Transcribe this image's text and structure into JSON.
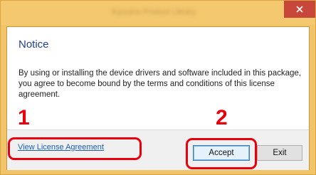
{
  "window": {
    "title": "Kyocera Product Library"
  },
  "notice": {
    "title": "Notice",
    "body": "By using or installing the device drivers and software included in this package, you agree to become bound by the terms and conditions of this license agreement."
  },
  "footer": {
    "link_label": "View License Agreement",
    "accept_label": "Accept",
    "exit_label": "Exit"
  },
  "callouts": {
    "one": "1",
    "two": "2"
  },
  "colors": {
    "titlebar": "#f3c86f",
    "close_button": "#c8463a",
    "heading": "#1f3f8c",
    "link": "#1a5fb4",
    "callout": "#e8000c"
  }
}
